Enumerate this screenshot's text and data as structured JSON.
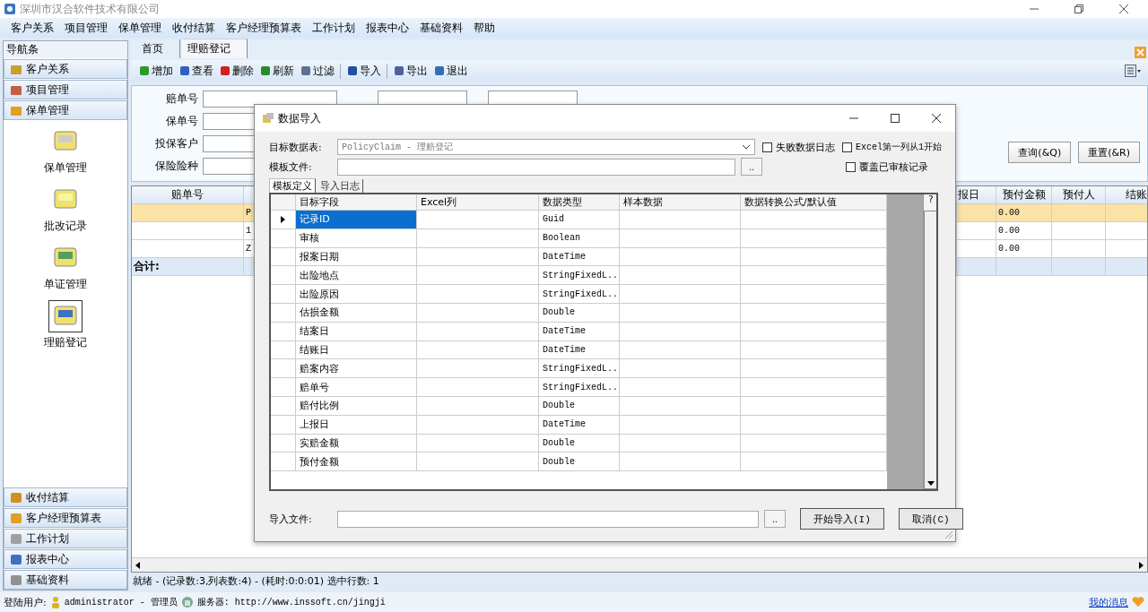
{
  "window": {
    "title": "深圳市汉合软件技术有限公司"
  },
  "menu": [
    "客户关系",
    "项目管理",
    "保单管理",
    "收付结算",
    "客户经理预算表",
    "工作计划",
    "报表中心",
    "基础资料",
    "帮助"
  ],
  "nav": {
    "title": "导航条",
    "top_items": [
      {
        "label": "客户关系"
      },
      {
        "label": "项目管理"
      },
      {
        "label": "保单管理"
      }
    ],
    "modules": [
      {
        "label": "保单管理",
        "selected": false
      },
      {
        "label": "批改记录",
        "selected": false
      },
      {
        "label": "单证管理",
        "selected": false
      },
      {
        "label": "理赔登记",
        "selected": true
      }
    ],
    "bottom_items": [
      {
        "label": "收付结算"
      },
      {
        "label": "客户经理预算表"
      },
      {
        "label": "工作计划"
      },
      {
        "label": "报表中心"
      },
      {
        "label": "基础资料"
      }
    ]
  },
  "tabs": [
    {
      "label": "首页",
      "selected": false
    },
    {
      "label": "理赔登记",
      "selected": true
    }
  ],
  "toolbar": [
    "增加",
    "查看",
    "删除",
    "刷新",
    "过滤",
    "导入",
    "导出",
    "退出"
  ],
  "filter": {
    "fields": [
      "赔单号",
      "保单号",
      "投保客户",
      "保险险种"
    ],
    "buttons": [
      "查询(&Q)",
      "重置(&R)"
    ]
  },
  "grid": {
    "columns": [
      "赔单号",
      "报日",
      "预付金额",
      "预付人",
      "结账"
    ],
    "rows": [
      {
        "selected": true,
        "column_2": "P",
        "prepaid": "0.00"
      },
      {
        "selected": false,
        "column_2": "1",
        "prepaid": "0.00"
      },
      {
        "selected": false,
        "column_2": "Z",
        "prepaid": "0.00"
      }
    ],
    "total_label": "合计:"
  },
  "status": "就绪 - (记录数:3,列表数:4) - (耗时:0:0:01) 选中行数: 1",
  "footer": {
    "user_label": "登陆用户:",
    "user": "administrator - 管理员",
    "server": "服务器: http://www.inssoft.cn/jingji",
    "messages": "我的消息"
  },
  "dialog": {
    "title": "数据导入",
    "target_label": "目标数据表:",
    "target_value": "PolicyClaim - 理赔登记",
    "template_label": "模板文件:",
    "checkboxes": [
      {
        "label": "失败数据日志",
        "checked": false
      },
      {
        "label": "Excel第一列从1开始",
        "checked": false
      },
      {
        "label": "覆盖已审核记录",
        "checked": false
      }
    ],
    "tabs": [
      {
        "label": "模板定义",
        "selected": true
      },
      {
        "label": "导入日志",
        "selected": false
      }
    ],
    "columns": [
      "目标字段",
      "Excel列",
      "数据类型",
      "样本数据",
      "数据转换公式/默认值"
    ],
    "help": "?",
    "rows": [
      {
        "field": "记录ID",
        "type": "Guid",
        "selected": true
      },
      {
        "field": "审核",
        "type": "Boolean",
        "selected": false
      },
      {
        "field": "报案日期",
        "type": "DateTime",
        "selected": false
      },
      {
        "field": "出险地点",
        "type": "StringFixedL..",
        "selected": false
      },
      {
        "field": "出险原因",
        "type": "StringFixedL..",
        "selected": false
      },
      {
        "field": "估损金额",
        "type": "Double",
        "selected": false
      },
      {
        "field": "结案日",
        "type": "DateTime",
        "selected": false
      },
      {
        "field": "结账日",
        "type": "DateTime",
        "selected": false
      },
      {
        "field": "赔案内容",
        "type": "StringFixedL..",
        "selected": false
      },
      {
        "field": "赔单号",
        "type": "StringFixedL..",
        "selected": false
      },
      {
        "field": "赔付比例",
        "type": "Double",
        "selected": false
      },
      {
        "field": "上报日",
        "type": "DateTime",
        "selected": false
      },
      {
        "field": "实赔金额",
        "type": "Double",
        "selected": false
      },
      {
        "field": "预付金额",
        "type": "Double",
        "selected": false
      }
    ],
    "file_label": "导入文件:",
    "browse": "..",
    "start": "开始导入(I)",
    "cancel": "取消(C)"
  }
}
